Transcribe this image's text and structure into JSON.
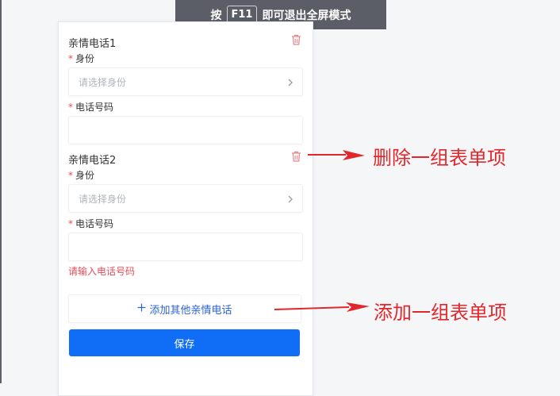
{
  "fullscreen_tip": {
    "prefix": "按",
    "key": "F11",
    "suffix": "即可退出全屏模式"
  },
  "form": {
    "groups": [
      {
        "title": "亲情电话1",
        "identity_label": "身份",
        "identity_placeholder": "请选择身份",
        "phone_label": "电话号码",
        "phone_value": "",
        "error": ""
      },
      {
        "title": "亲情电话2",
        "identity_label": "身份",
        "identity_placeholder": "请选择身份",
        "phone_label": "电话号码",
        "phone_value": "",
        "error": "请输入电话号码"
      }
    ],
    "required_mark": "*",
    "add_label": "添加其他亲情电话",
    "save_label": "保存"
  },
  "annotations": {
    "delete_note": "删除一组表单项",
    "add_note": "添加一组表单项"
  },
  "colors": {
    "primary": "#0f6ef5",
    "danger": "#e34d59",
    "annotation_red": "#e2272c",
    "link_blue": "#2a63d6"
  },
  "icons": {
    "delete": "trash-icon",
    "select": "chevron-right-icon",
    "add": "plus-icon"
  }
}
